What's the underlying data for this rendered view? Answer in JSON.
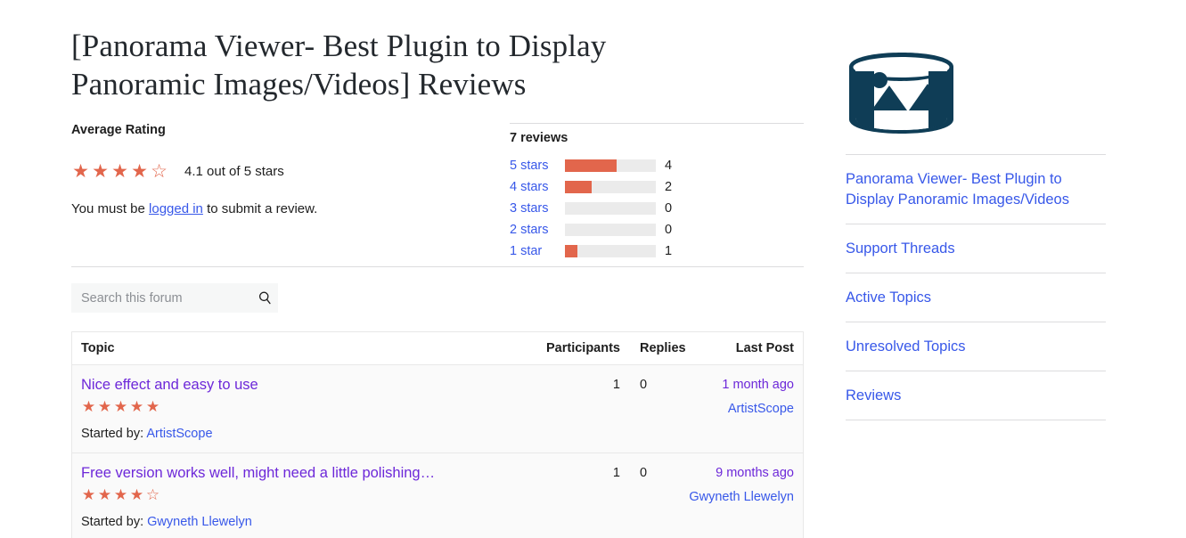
{
  "page_title": "[Panorama Viewer- Best Plugin to Display Panoramic Images/Videos] Reviews",
  "rating": {
    "average_label": "Average Rating",
    "filled_stars": 4,
    "total_stars": 5,
    "average_text": "4.1 out of 5 stars",
    "login_note_before": "You must be ",
    "login_link": "logged in",
    "login_note_after": " to submit a review."
  },
  "breakdown": {
    "title": "7 reviews",
    "rows": [
      {
        "label": "5 stars",
        "count": "4",
        "percent": 57
      },
      {
        "label": "4 stars",
        "count": "2",
        "percent": 29
      },
      {
        "label": "3 stars",
        "count": "0",
        "percent": 0
      },
      {
        "label": "2 stars",
        "count": "0",
        "percent": 0
      },
      {
        "label": "1 star",
        "count": "1",
        "percent": 14
      }
    ]
  },
  "search": {
    "value": "",
    "placeholder": "Search this forum",
    "icon": "search-icon"
  },
  "table": {
    "headers": {
      "topic": "Topic",
      "participants": "Participants",
      "replies": "Replies",
      "last_post": "Last Post"
    },
    "started_by_label": "Started by:",
    "rows": [
      {
        "title": "Nice effect and easy to use",
        "stars": 5,
        "author": "ArtistScope",
        "participants": "1",
        "replies": "0",
        "last_post_time": "1 month ago",
        "last_post_author": "ArtistScope"
      },
      {
        "title": "Free version works well, might need a little polishing…",
        "stars": 4,
        "author": "Gwyneth Llewelyn",
        "participants": "1",
        "replies": "0",
        "last_post_time": "9 months ago",
        "last_post_author": "Gwyneth Llewelyn"
      }
    ]
  },
  "sidebar": {
    "logo_name": "panorama-viewer-logo",
    "items": [
      {
        "label": "Panorama Viewer- Best Plugin to Display Panoramic Images/Videos",
        "name": "sidebar-item-plugin"
      },
      {
        "label": "Support Threads",
        "name": "sidebar-item-support-threads"
      },
      {
        "label": "Active Topics",
        "name": "sidebar-item-active-topics"
      },
      {
        "label": "Unresolved Topics",
        "name": "sidebar-item-unresolved-topics"
      },
      {
        "label": "Reviews",
        "name": "sidebar-item-reviews"
      }
    ]
  },
  "colors": {
    "star": "#e2664c",
    "bar_fill": "#e2664c",
    "bar_track": "#ebebeb",
    "link": "#3858e9",
    "visited_link": "#6d28d9",
    "logo": "#0f3d56"
  },
  "glyphs": {
    "star_filled": "★",
    "star_empty": "☆"
  }
}
